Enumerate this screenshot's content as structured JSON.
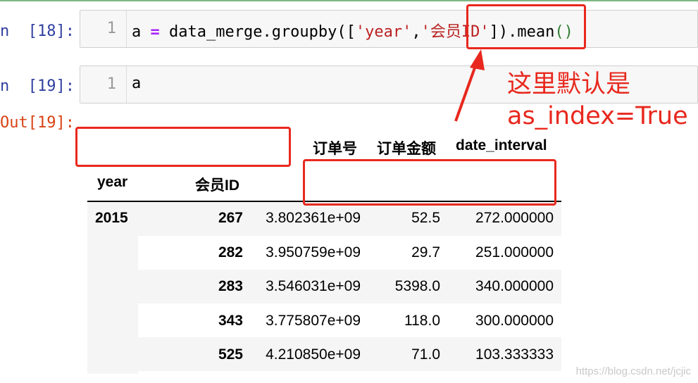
{
  "cells": [
    {
      "prompt": "n  [18]:",
      "line_number": "1",
      "code": {
        "var": "a",
        "op": "=",
        "call": "data_merge.groupby([",
        "str1": "'year'",
        "comma": ",",
        "str2": "'会员ID'",
        "close": "]).mean",
        "parens": "()"
      }
    },
    {
      "prompt": "n  [19]:",
      "line_number": "1",
      "code_text": "a"
    }
  ],
  "output": {
    "prompt": "Out[19]:",
    "columns": [
      "订单号",
      "订单金额",
      "date_interval"
    ],
    "index_names": [
      "year",
      "会员ID"
    ],
    "rows": [
      {
        "year": "2015",
        "member_id": "267",
        "order_no": "3.802361e+09",
        "amount": "52.5",
        "date_interval": "272.000000"
      },
      {
        "year": "",
        "member_id": "282",
        "order_no": "3.950759e+09",
        "amount": "29.7",
        "date_interval": "251.000000"
      },
      {
        "year": "",
        "member_id": "283",
        "order_no": "3.546031e+09",
        "amount": "5398.0",
        "date_interval": "340.000000"
      },
      {
        "year": "",
        "member_id": "343",
        "order_no": "3.775807e+09",
        "amount": "118.0",
        "date_interval": "300.000000"
      },
      {
        "year": "",
        "member_id": "525",
        "order_no": "4.210850e+09",
        "amount": "71.0",
        "date_interval": "103.333333"
      }
    ]
  },
  "annotation": {
    "line1": "这里默认是",
    "line2": "as_index=True",
    "color": "#e8281e"
  },
  "watermark": "https://blog.csdn.net/jcjic",
  "colors": {
    "prompt_in": "#303f9f",
    "prompt_out": "#d84315",
    "string": "#ba2121",
    "operator": "#aa22ff",
    "row_stripe": "#f5f5f5"
  }
}
